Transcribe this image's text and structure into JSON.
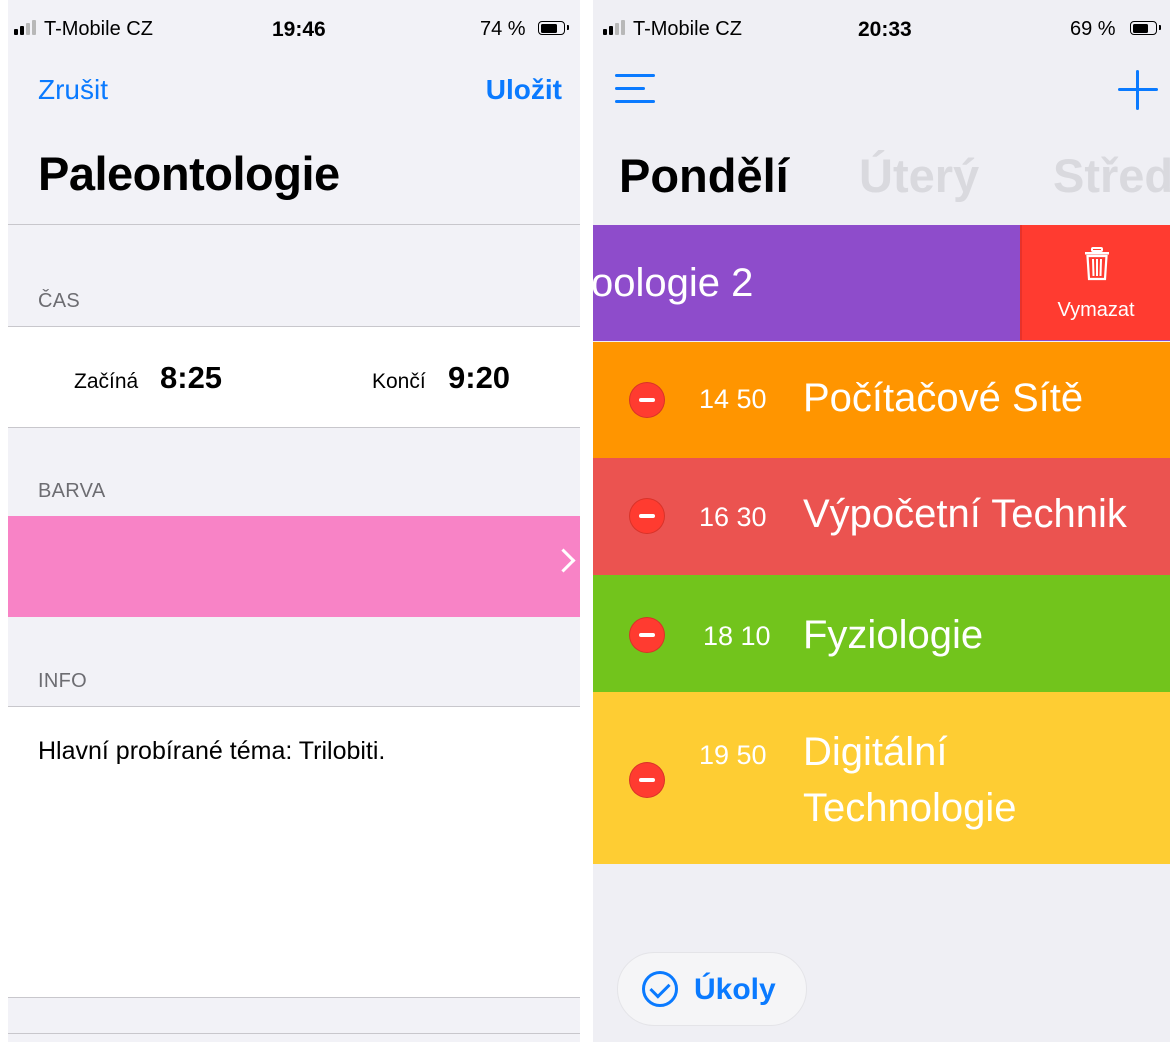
{
  "left_screen": {
    "status_bar": {
      "carrier": "T-Mobile CZ",
      "time": "19:46",
      "battery": "74 %",
      "battery_level": 0.74
    },
    "nav": {
      "cancel": "Zrušit",
      "save": "Uložit"
    },
    "title": "Paleontologie",
    "time_section": {
      "header": "ČAS",
      "start_label": "Začíná",
      "start_value": "8:25",
      "end_label": "Končí",
      "end_value": "9:20"
    },
    "color_section": {
      "header": "BARVA",
      "selected_color": "#f883c6"
    },
    "info_section": {
      "header": "INFO",
      "text": "Hlavní probírané téma: Trilobiti."
    }
  },
  "right_screen": {
    "status_bar": {
      "carrier": "T-Mobile CZ",
      "time": "20:33",
      "battery": "69 %",
      "battery_level": 0.69
    },
    "days": [
      "Pondělí",
      "Úterý",
      "Střed"
    ],
    "swiped_row": {
      "title": "oologie 2",
      "color": "#8e4ccb",
      "delete_label": "Vymazat"
    },
    "lessons": [
      {
        "time": "14 50",
        "title": "Počítačové Sítě",
        "color": "#ff9500"
      },
      {
        "time": "16 30",
        "title": "Výpočetní Technik",
        "color": "#eb5350"
      },
      {
        "time": "18 10",
        "title": "Fyziologie",
        "color": "#72c41c"
      },
      {
        "time": "19 50",
        "title_line1": "Digitální",
        "title_line2": "Technologie",
        "color": "#fecd33"
      }
    ],
    "tasks_button": "Úkoly",
    "accent_color": "#0a7aff"
  }
}
